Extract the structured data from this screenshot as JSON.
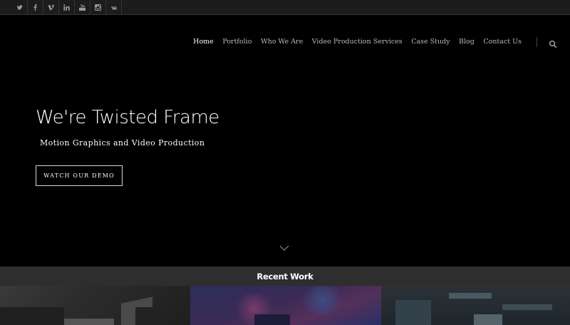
{
  "topbar": {
    "social": [
      {
        "name": "twitter-icon"
      },
      {
        "name": "facebook-icon"
      },
      {
        "name": "vimeo-icon"
      },
      {
        "name": "linkedin-icon"
      },
      {
        "name": "youtube-icon"
      },
      {
        "name": "instagram-icon"
      },
      {
        "name": "vk-icon"
      }
    ]
  },
  "nav": {
    "items": [
      {
        "label": "Home"
      },
      {
        "label": "Portfolio"
      },
      {
        "label": "Who We Are"
      },
      {
        "label": "Video Production Services"
      },
      {
        "label": "Case Study"
      },
      {
        "label": "Blog"
      },
      {
        "label": "Contact Us"
      }
    ],
    "active_index": 0,
    "search_icon": "search-icon"
  },
  "hero": {
    "title": "We're Twisted Frame",
    "subtitle": "Motion Graphics and Video Production",
    "cta_label": "WATCH OUR DEMO",
    "scroll_icon": "chevron-down-icon"
  },
  "recent": {
    "title": "Recent Work"
  },
  "colors": {
    "background": "#000000",
    "topbar": "#1c1c1c",
    "recent_bar": "#2e2e2e",
    "nav_text": "#b8b8b8",
    "nav_active": "#ffffff"
  }
}
